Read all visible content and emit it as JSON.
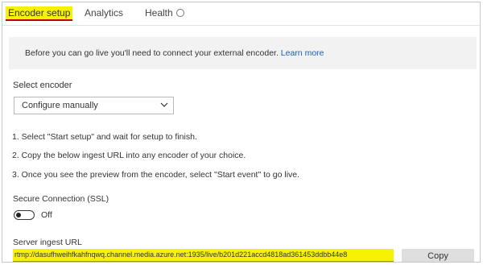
{
  "tabs": [
    {
      "label": "Encoder setup",
      "active": true
    },
    {
      "label": "Analytics",
      "active": false
    },
    {
      "label": "Health",
      "active": false,
      "icon": "info-circle-icon"
    }
  ],
  "banner": {
    "text": "Before you can go live you'll need to connect your external encoder.",
    "link": "Learn more"
  },
  "encoder": {
    "label": "Select encoder",
    "selected": "Configure manually",
    "icon": "chevron-down-icon"
  },
  "steps": [
    "1.  Select \"Start setup\" and wait for setup to finish.",
    "2.  Copy the below ingest URL into any encoder of your choice.",
    "3.  Once you see the preview from the encoder, select \"Start event\" to go live."
  ],
  "ssl": {
    "label": "Secure Connection (SSL)",
    "state": "Off",
    "enabled": false
  },
  "ingest": {
    "label": "Server ingest URL",
    "url": "rtmp://dasufhweihfkahfnqwq.channel.media.azure.net:1935/live/b201d221accd4818ad361453ddbb44e8",
    "copy_label": "Copy"
  },
  "colors": {
    "highlight": "#f7f300",
    "active_underline": "#c00000",
    "link": "#1a5fb4",
    "banner_bg": "#f2f2f2",
    "button_bg": "#dedede"
  }
}
